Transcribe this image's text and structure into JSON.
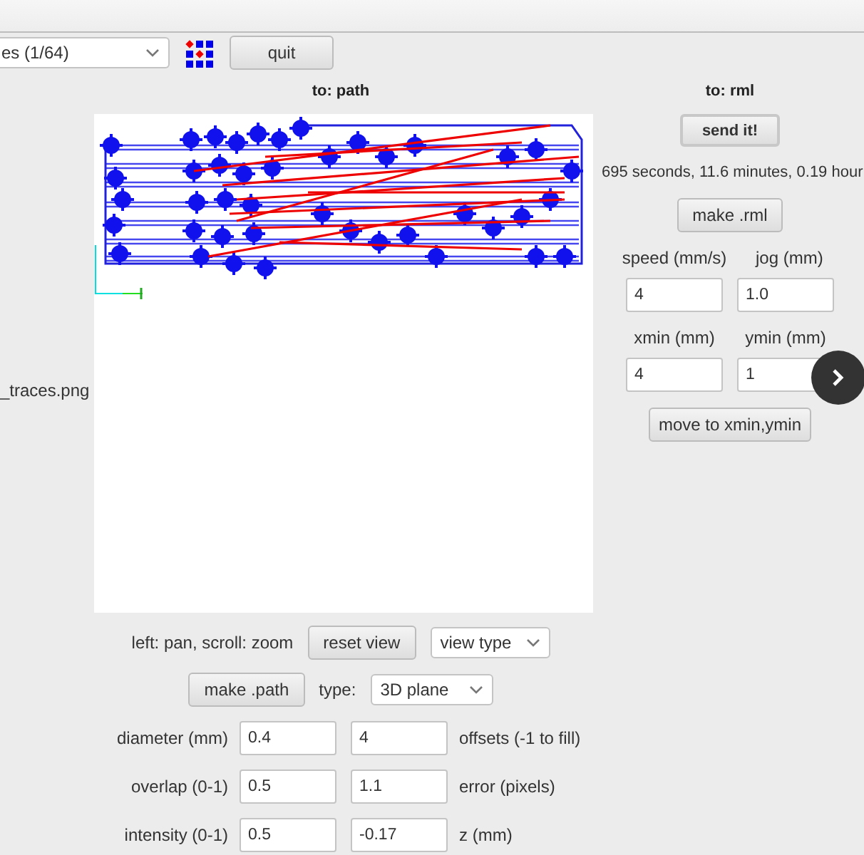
{
  "toolbar": {
    "file_select": {
      "value": "es (1/64)"
    },
    "quit_button": "quit"
  },
  "file_label": "_traces.png",
  "path_panel": {
    "heading": "to: path",
    "view_hint": "left: pan, scroll: zoom",
    "reset_button": "reset view",
    "view_select": {
      "value": "view type"
    },
    "make_button": "make .path",
    "type_label": "type:",
    "type_select": {
      "value": "3D plane"
    },
    "params": [
      {
        "label": "diameter (mm)",
        "value": "0.4",
        "value_2": "4",
        "label_2": "offsets (-1 to fill)"
      },
      {
        "label": "overlap (0-1)",
        "value": "0.5",
        "value_2": "1.1",
        "label_2": "error (pixels)"
      },
      {
        "label": "intensity (0-1)",
        "value": "0.5",
        "value_2": "-0.17",
        "label_2": "z (mm)"
      }
    ]
  },
  "rml_panel": {
    "heading": "to: rml",
    "send_button": "send it!",
    "estimate": "695 seconds, 11.6 minutes, 0.19 hour",
    "make_button": "make .rml",
    "field_rows": [
      [
        {
          "label": "speed (mm/s)",
          "value": "4"
        },
        {
          "label": "jog (mm)",
          "value": "1.0"
        }
      ],
      [
        {
          "label": "xmin (mm)",
          "value": "4"
        },
        {
          "label": "ymin (mm)",
          "value": "1"
        }
      ]
    ],
    "move_button": "move to xmin,ymin"
  }
}
